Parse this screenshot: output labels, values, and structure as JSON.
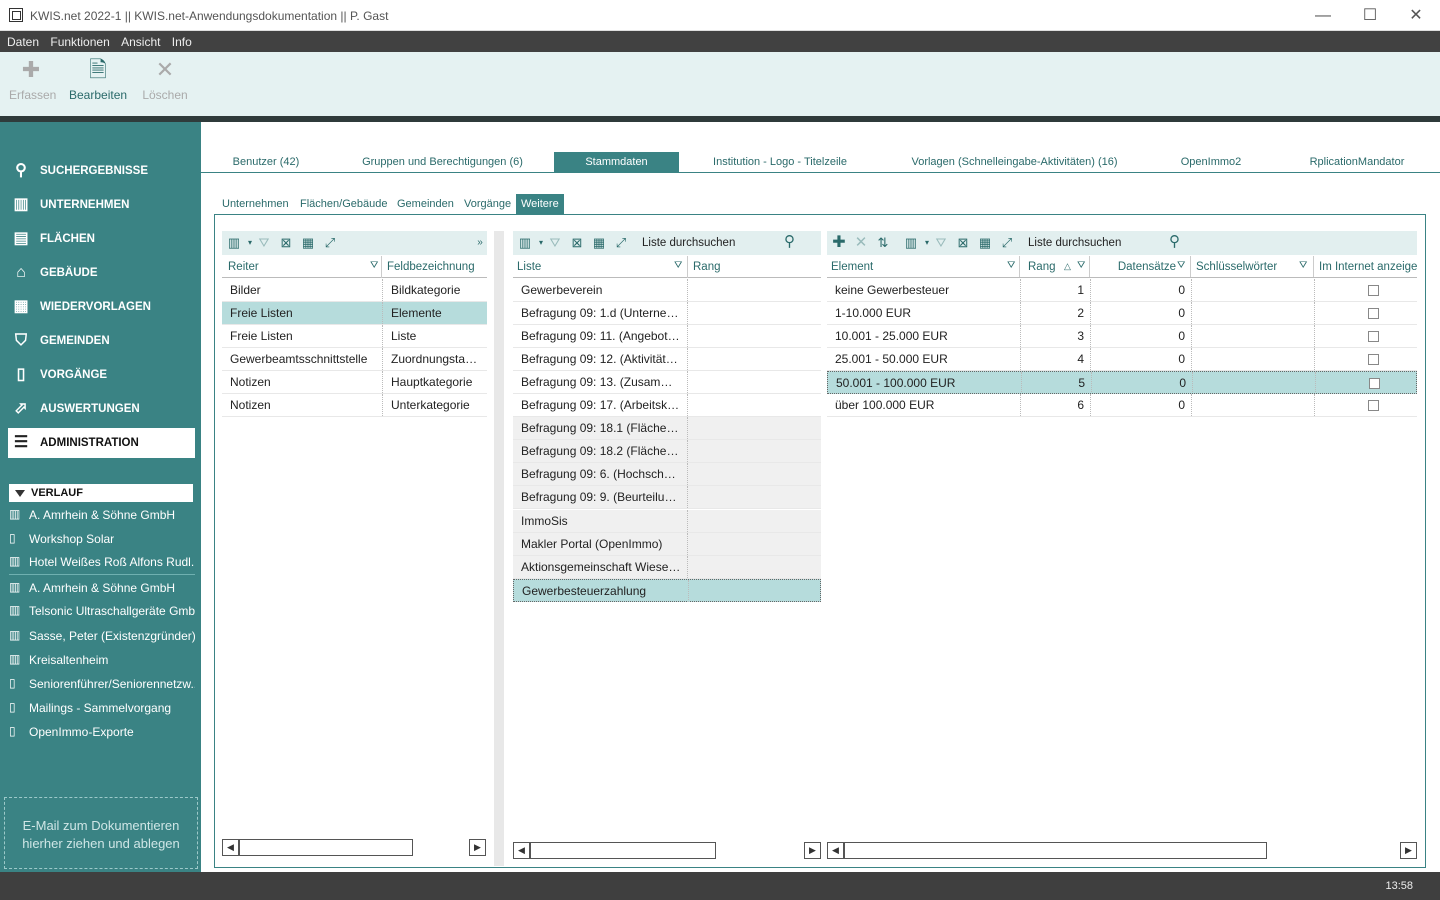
{
  "window": {
    "title": "KWIS.net 2022-1 || KWIS.net-Anwendungsdokumentation || P. Gast",
    "minimize": "—",
    "maximize": "☐",
    "close": "✕"
  },
  "menu": [
    "Daten",
    "Funktionen",
    "Ansicht",
    "Info"
  ],
  "ribbon": {
    "erfassen": "Erfassen",
    "bearbeiten": "Bearbeiten",
    "loeschen": "Löschen"
  },
  "nav": [
    {
      "label": "SUCHERGEBNISSE",
      "icon": "search-icon"
    },
    {
      "label": "UNTERNEHMEN",
      "icon": "building-icon"
    },
    {
      "label": "FLÄCHEN",
      "icon": "area-icon"
    },
    {
      "label": "GEBÄUDE",
      "icon": "house-icon"
    },
    {
      "label": "WIEDERVORLAGEN",
      "icon": "calendar-icon"
    },
    {
      "label": "GEMEINDEN",
      "icon": "shield-icon"
    },
    {
      "label": "VORGÄNGE",
      "icon": "document-icon"
    },
    {
      "label": "AUSWERTUNGEN",
      "icon": "chart-icon"
    },
    {
      "label": "ADMINISTRATION",
      "icon": "settings-icon"
    }
  ],
  "verlauf": {
    "title": "VERLAUF",
    "items": [
      "A. Amrhein & Söhne GmbH",
      "Workshop Solar",
      "Hotel Weißes Roß Alfons Rudl...",
      "A. Amrhein & Söhne GmbH",
      "Telsonic Ultraschallgeräte Gmb...",
      "Sasse, Peter (Existenzgründer)",
      "Kreisaltenheim",
      "Seniorenführer/Seniorennetzw...",
      "Mailings - Sammelvorgang",
      "OpenImmo-Exporte"
    ]
  },
  "dropzone": {
    "line1": "E-Mail  zum Dokumentieren",
    "line2": "hierher ziehen und ablegen"
  },
  "tabs": [
    "Benutzer (42)",
    "Gruppen und Berechtigungen (6)",
    "Stammdaten",
    "Institution - Logo - Titelzeile",
    "Vorlagen (Schnelleingabe-Aktivitäten) (16)",
    "OpenImmo2",
    "RplicationMandator"
  ],
  "subtabs": [
    "Unternehmen",
    "Flächen/Gebäude",
    "Gemeinden",
    "Vorgänge",
    "Weitere"
  ],
  "left_grid": {
    "headers": [
      "Reiter",
      "Feldbezeichnung"
    ],
    "rows": [
      [
        "Bilder",
        "Bildkategorie"
      ],
      [
        "Freie Listen",
        "Elemente"
      ],
      [
        "Freie Listen",
        "Liste"
      ],
      [
        "Gewerbeamtsschnittstelle",
        "Zuordnungstabelle"
      ],
      [
        "Notizen",
        "Hauptkategorie"
      ],
      [
        "Notizen",
        "Unterkategorie"
      ]
    ]
  },
  "middle_grid": {
    "search_placeholder": "Liste durchsuchen",
    "headers": [
      "Liste",
      "Rang"
    ],
    "rows": [
      "Gewerbeverein",
      "Befragung 09: 1.d (Unternehm...",
      "Befragung 09: 11. (Angebote...",
      "Befragung 09: 12. (Aktivitäten...",
      "Befragung 09: 13. (Zusammen...",
      "Befragung 09: 17. (Arbeitskräft...",
      "Befragung 09: 18.1 (Flächenü...",
      "Befragung 09: 18.2 (Flächenb...",
      "Befragung 09: 6. (Hochschulk...",
      "Befragung 09: 9. (Beurteilung...",
      "ImmoSis",
      "Makler Portal (OpenImmo)",
      "Aktionsgemeinschaft Wieseng...",
      "Gewerbesteuerzahlung"
    ]
  },
  "right_grid": {
    "search_placeholder": "Liste durchsuchen",
    "headers": [
      "Element",
      "Rang",
      "Datensätze",
      "Schlüsselwörter",
      "Im Internet anzeigen"
    ],
    "rows": [
      [
        "keine Gewerbesteuer",
        "1",
        "0"
      ],
      [
        "1-10.000 EUR",
        "2",
        "0"
      ],
      [
        "10.001 - 25.000 EUR",
        "3",
        "0"
      ],
      [
        "25.001 - 50.000 EUR",
        "4",
        "0"
      ],
      [
        "50.001 - 100.000 EUR",
        "5",
        "0"
      ],
      [
        "über 100.000 EUR",
        "6",
        "0"
      ]
    ]
  },
  "status": {
    "time": "13:58"
  },
  "colors": {
    "accent": "#3a8384",
    "selected_row": "#b6dcdc",
    "ribbon_bg": "#e5f2f2"
  }
}
